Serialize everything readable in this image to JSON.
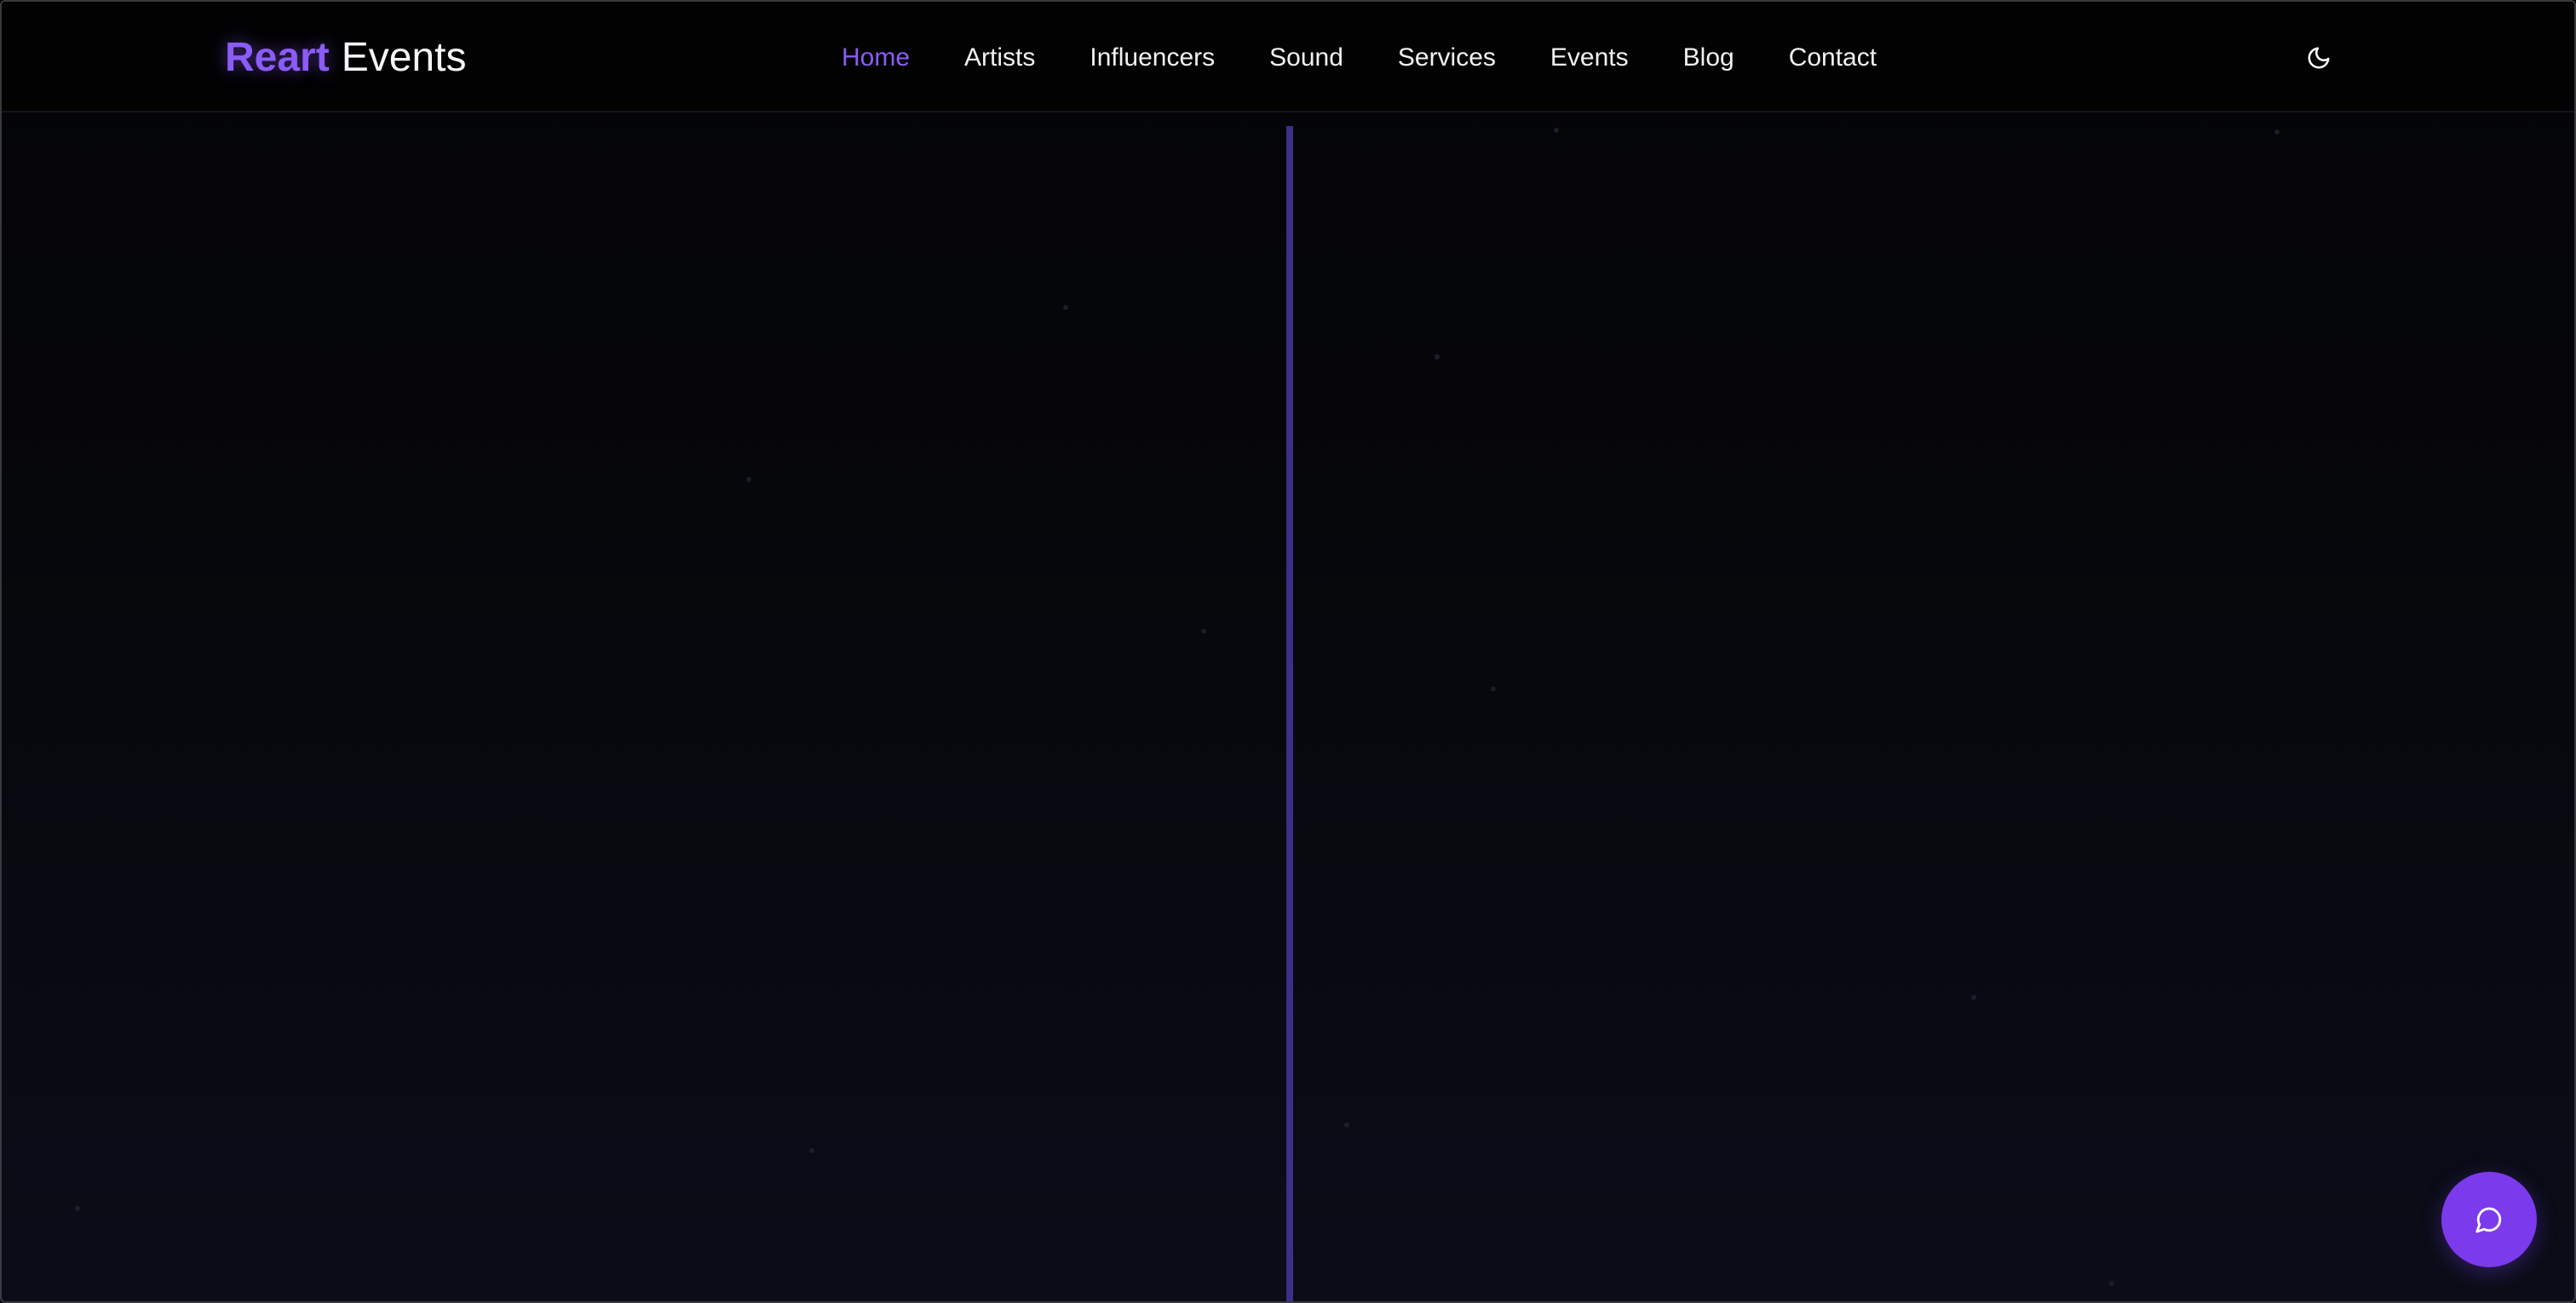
{
  "header": {
    "logo": {
      "accent": "Reart",
      "rest": "Events"
    },
    "nav": [
      {
        "label": "Home",
        "active": true
      },
      {
        "label": "Artists",
        "active": false
      },
      {
        "label": "Influencers",
        "active": false
      },
      {
        "label": "Sound",
        "active": false
      },
      {
        "label": "Services",
        "active": false
      },
      {
        "label": "Events",
        "active": false
      },
      {
        "label": "Blog",
        "active": false
      },
      {
        "label": "Contact",
        "active": false
      }
    ],
    "theme_toggle_icon": "moon-icon"
  },
  "chat": {
    "icon": "chat-bubble-icon"
  },
  "colors": {
    "accent": "#8b5cf6",
    "chat_button": "#7c3aed",
    "divider": "#3b2f86",
    "background": "#05060a"
  }
}
